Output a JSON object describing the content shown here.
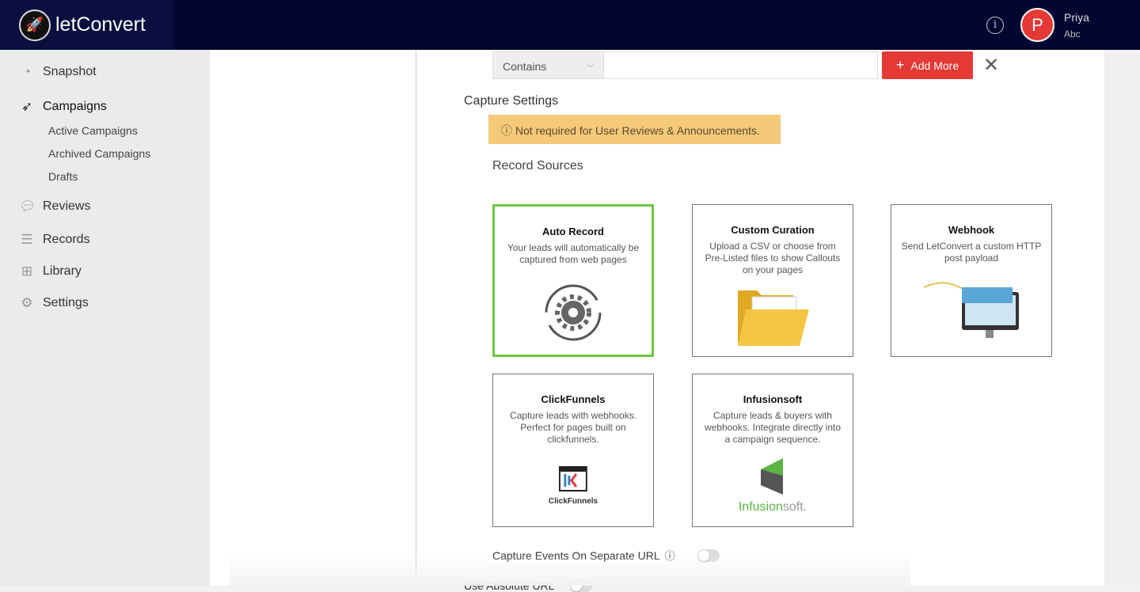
{
  "header": {
    "logo_text_light": "let",
    "logo_text_bold": "Convert",
    "user_initial": "P",
    "user_name": "Priya",
    "user_org": "Abc"
  },
  "sidebar": {
    "items": [
      {
        "label": "Snapshot"
      },
      {
        "label": "Campaigns"
      },
      {
        "label": "Reviews"
      },
      {
        "label": "Records"
      },
      {
        "label": "Library"
      },
      {
        "label": "Settings"
      }
    ],
    "sub_items": [
      {
        "label": "Active Campaigns"
      },
      {
        "label": "Archived Campaigns"
      },
      {
        "label": "Drafts"
      }
    ]
  },
  "filter": {
    "condition": "Contains",
    "value": "",
    "add_more_label": "Add More"
  },
  "capture": {
    "title": "Capture Settings",
    "warning": "Not required for User Reviews & Announcements.",
    "sources_title": "Record Sources",
    "cards": [
      {
        "title": "Auto Record",
        "desc": "Your leads will automatically be captured from web pages"
      },
      {
        "title": "Custom Curation",
        "desc": "Upload a CSV or choose from Pre-Listed files to show Callouts on your pages"
      },
      {
        "title": "Webhook",
        "desc": "Send LetConvert a custom HTTP post payload"
      },
      {
        "title": "ClickFunnels",
        "desc": "Capture leads with webhooks. Perfect for pages built on clickfunnels.",
        "logo_text": "ClickFunnels"
      },
      {
        "title": "Infusionsoft",
        "desc": "Capture leads & buyers with webhooks. Integrate directly into a campaign sequence.",
        "logo_text_a": "Infusion",
        "logo_text_b": "soft."
      }
    ],
    "separate_url_label": "Capture Events On Separate URL",
    "absolute_url_label": "Use Absolute URL"
  },
  "colors": {
    "accent": "#e53935",
    "selected": "#6cc644",
    "warning": "#f5c97a",
    "topbar": "#020631"
  }
}
